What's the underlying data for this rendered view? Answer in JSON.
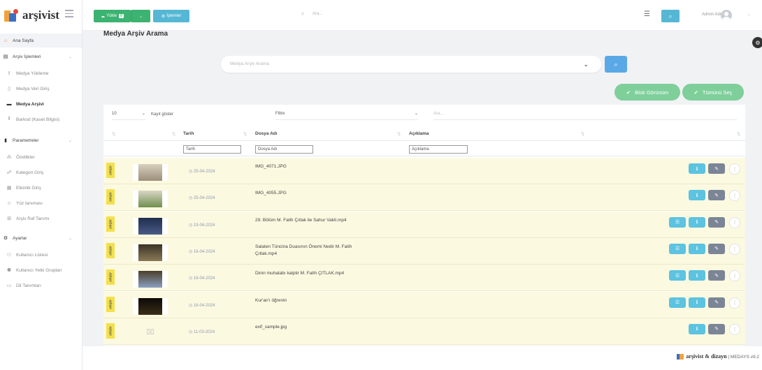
{
  "app": {
    "logo_text": "arşivist"
  },
  "sidebar": {
    "items": [
      {
        "label": "Ana Sayfa",
        "icon": "home-icon"
      },
      {
        "label": "Arşiv İşlemleri",
        "icon": "archive-icon"
      },
      {
        "label": "Medya Yükleme",
        "icon": "upload-icon"
      },
      {
        "label": "Medya Veri Giriş",
        "icon": "document-icon"
      },
      {
        "label": "Medya Arşivi",
        "icon": "archive-box-icon"
      },
      {
        "label": "Barkod (Kaset Bilgisi)",
        "icon": "barcode-icon"
      },
      {
        "label": "Parametreler",
        "icon": "book-icon"
      },
      {
        "label": "Özellikler",
        "icon": "nodes-icon"
      },
      {
        "label": "Kategori Giriş",
        "icon": "sitemap-icon"
      },
      {
        "label": "Etkinlik Giriş",
        "icon": "calendar-icon"
      },
      {
        "label": "Yüz tanıması",
        "icon": "face-icon"
      },
      {
        "label": "Arşiv Raf Tanımı",
        "icon": "grid-icon"
      },
      {
        "label": "Ayarlar",
        "icon": "gear-icon"
      },
      {
        "label": "Kullanıcı Listesi",
        "icon": "users-icon"
      },
      {
        "label": "Kullanıcı Yetki Grupları",
        "icon": "user-group-icon"
      },
      {
        "label": "Dil Tanımları",
        "icon": "language-icon"
      }
    ]
  },
  "topbar": {
    "upload_label": "Yükle",
    "upload_count": "0",
    "operations_label": "İşlemler",
    "search_placeholder": "Ara...",
    "user_name": "Admin Admin"
  },
  "page": {
    "title": "Medya Arşiv Arama"
  },
  "search": {
    "placeholder": "Medya Arşiv Arama"
  },
  "actions": {
    "block_view": "Blok Görünüm",
    "select_all": "Tümünü Seç"
  },
  "table": {
    "page_size": "10",
    "page_size_label": "Kayıt göster",
    "filter_label": "Filtre",
    "search_placeholder": "Ara...",
    "headers": [
      "Tarih",
      "Dosya Adı",
      "Açıklama"
    ],
    "filter_placeholders": [
      "Tarih",
      "Dosya Adı",
      "Açıklama"
    ],
    "tag_label": "ARŞİV",
    "rows": [
      {
        "date": "25-04-2024",
        "file": "IMG_4071.JPG",
        "has_list": false
      },
      {
        "date": "25-04-2024",
        "file": "IMG_4055.JPG",
        "has_list": false
      },
      {
        "date": "19-04-2024",
        "file": "29. Bölüm M. Fatih Çıtlak ile Sahur Vakti.mp4",
        "has_list": true
      },
      {
        "date": "16-04-2024",
        "file": "Salaten Tüncina Duasının Önemi Nedir M. Fatih Çıtlak.mp4",
        "has_list": true
      },
      {
        "date": "16-04-2024",
        "file": "Dinin muhatabı kalptir M. Fatih ÇITLAK.mp4",
        "has_list": true
      },
      {
        "date": "16-04-2024",
        "file": "Kur'an'ı öğrenin",
        "has_list": true
      },
      {
        "date": "11-03-2024",
        "file": "exif_sample.jpg",
        "has_list": false
      }
    ]
  },
  "footer": {
    "brand": "arşivist & dizayn",
    "version": "| MEDAYS v9.2"
  },
  "colors": {
    "green": "#3cb371",
    "teal": "#55b7d4",
    "row_bg": "#fcf9e1",
    "tag": "#f3e04c"
  }
}
